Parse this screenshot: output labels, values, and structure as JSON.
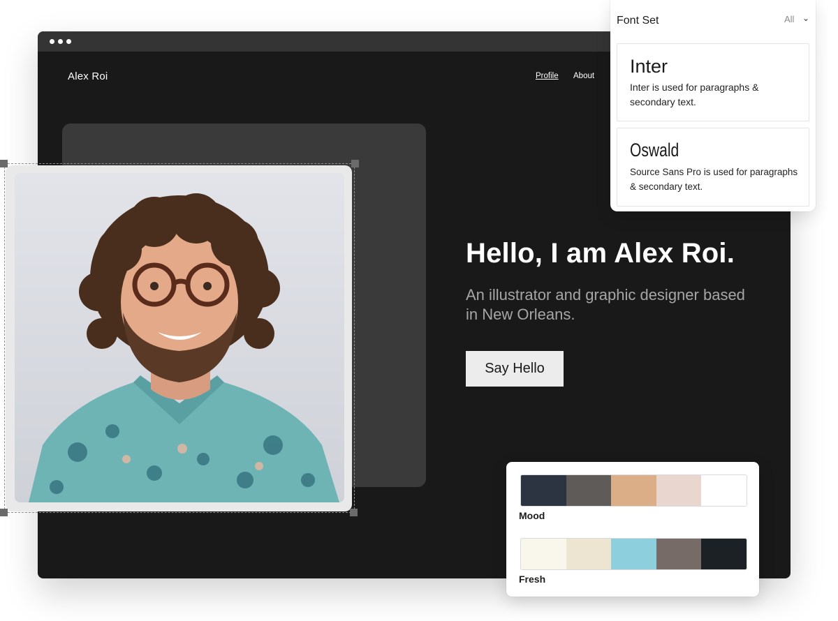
{
  "browser": {
    "brand": "Alex Roi",
    "nav": {
      "profile": "Profile",
      "about": "About"
    },
    "hero": {
      "heading": "Hello, I am Alex Roi.",
      "subheading": "An illustrator and graphic designer based in New Orleans.",
      "cta": "Say Hello"
    }
  },
  "font_panel": {
    "title": "Font Set",
    "filter": "All",
    "fonts": [
      {
        "name": "Inter",
        "description": "Inter is used for paragraphs & secondary text."
      },
      {
        "name": "Oswald",
        "description": "Source Sans Pro is used for paragraphs & secondary text."
      }
    ]
  },
  "palettes": [
    {
      "label": "Mood",
      "colors": [
        "#2b3440",
        "#5e5b59",
        "#dcae88",
        "#e8d6cf",
        "#ffffff"
      ]
    },
    {
      "label": "Fresh",
      "colors": [
        "#f9f7ec",
        "#ede4d1",
        "#8dcfdd",
        "#776b67",
        "#1b2124"
      ]
    }
  ],
  "icons": [
    "window-dots-icon",
    "chevron-down-icon",
    "portrait-photo"
  ]
}
